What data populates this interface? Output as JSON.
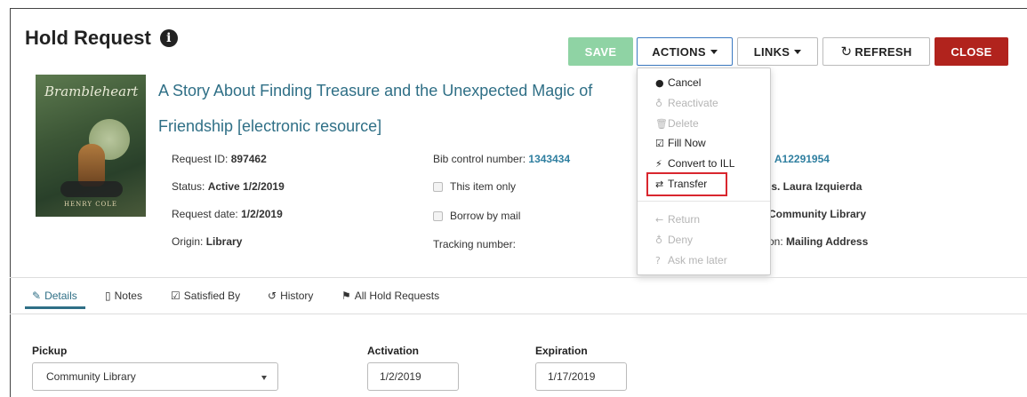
{
  "page": {
    "title": "Hold Request",
    "info_icon": "i"
  },
  "toolbar": {
    "save_label": "SAVE",
    "actions_label": "ACTIONS",
    "links_label": "LINKS",
    "refresh_label": "REFRESH",
    "close_label": "CLOSE",
    "save_color": "#8fd3a4",
    "close_color": "#b1231d"
  },
  "book": {
    "title_line1": "A Story About Finding Treasure and the Unexpected Magic of",
    "title_line2": "Friendship [electronic resource]",
    "cover_title": "Brambleheart",
    "cover_author": "HENRY COLE"
  },
  "details": {
    "request_id_label": "Request ID:",
    "request_id": "897462",
    "status_label": "Status:",
    "status": "Active 1/2/2019",
    "request_date_label": "Request date:",
    "request_date": "1/2/2019",
    "origin_label": "Origin:",
    "origin": "Library",
    "bib_label": "Bib control number:",
    "bib": "1343434",
    "this_item_only": "This item only",
    "borrow_by_mail": "Borrow by mail",
    "tracking_label": "Tracking number:",
    "patron_barcode_partial": ": A12291954",
    "patron_name_partial": "ls. Laura Izquierda",
    "library_partial": "Community Library",
    "location_partial_label": "on:",
    "location_partial": "Mailing Address"
  },
  "actions_menu": {
    "items": [
      {
        "label": "Cancel",
        "icon": "cancel-icon",
        "glyph": "●",
        "disabled": false
      },
      {
        "label": "Reactivate",
        "icon": "thumbs-up-icon",
        "glyph": "♁",
        "disabled": true
      },
      {
        "label": "Delete",
        "icon": "trash-icon",
        "glyph": "🗑",
        "disabled": true
      },
      {
        "label": "Fill Now",
        "icon": "check-square-icon",
        "glyph": "☑",
        "disabled": false
      },
      {
        "label": "Convert to ILL",
        "icon": "lightning-icon",
        "glyph": "⚡",
        "disabled": false
      },
      {
        "label": "Transfer",
        "icon": "transfer-icon",
        "glyph": "⇄",
        "disabled": false
      },
      {
        "label": "Return",
        "icon": "arrow-left-icon",
        "glyph": "←",
        "disabled": true
      },
      {
        "label": "Deny",
        "icon": "thumbs-down-icon",
        "glyph": "♁",
        "disabled": true
      },
      {
        "label": "Ask me later",
        "icon": "question-icon",
        "glyph": "?",
        "disabled": true
      }
    ],
    "highlight_color": "#d9262e"
  },
  "tabs": [
    {
      "label": "Details",
      "icon": "edit-icon",
      "active": true
    },
    {
      "label": "Notes",
      "icon": "file-icon",
      "active": false
    },
    {
      "label": "Satisfied By",
      "icon": "check-square-icon",
      "active": false
    },
    {
      "label": "History",
      "icon": "history-icon",
      "active": false
    },
    {
      "label": "All Hold Requests",
      "icon": "flag-icon",
      "active": false
    }
  ],
  "form": {
    "pickup_label": "Pickup",
    "pickup_value": "Community Library",
    "activation_label": "Activation",
    "activation_value": "1/2/2019",
    "expiration_label": "Expiration",
    "expiration_value": "1/17/2019"
  }
}
